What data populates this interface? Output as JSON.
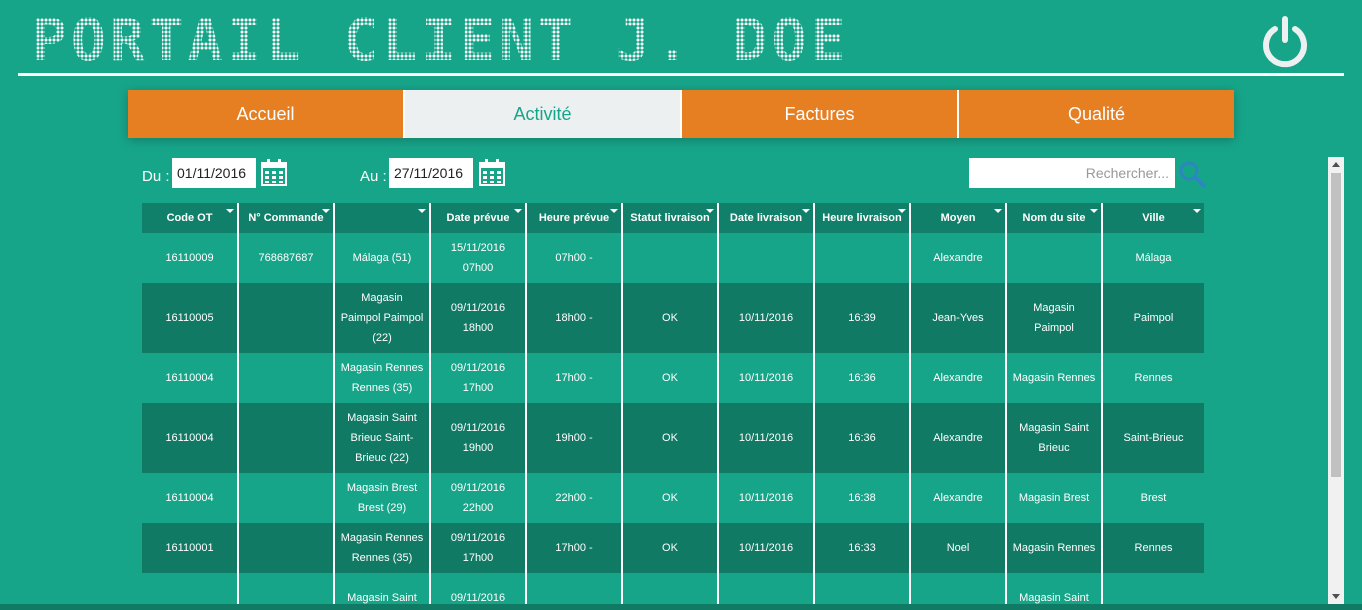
{
  "header": {
    "title": "PORTAIL CLIENT J. DOE",
    "power_icon": "power-icon"
  },
  "tabs": [
    {
      "label": "Accueil",
      "active": false
    },
    {
      "label": "Activité",
      "active": true
    },
    {
      "label": "Factures",
      "active": false
    },
    {
      "label": "Qualité",
      "active": false
    }
  ],
  "filters": {
    "from_label": "Du :",
    "from_value": "01/11/2016",
    "to_label": "Au :",
    "to_value": "27/11/2016",
    "calendar_icon": "calendar-icon",
    "search_placeholder": "Rechercher...",
    "search_icon": "search-icon"
  },
  "table": {
    "columns": [
      "Code OT",
      "N° Commande",
      "",
      "Date prévue",
      "Heure prévue",
      "Statut livraison",
      "Date livraison",
      "Heure livraison",
      "Moyen",
      "Nom du site",
      "Ville"
    ],
    "rows": [
      [
        "16110009",
        "768687687",
        "Málaga (51)",
        "15/11/2016\n07h00",
        "07h00 -",
        "",
        "",
        "",
        "Alexandre",
        "",
        "Málaga"
      ],
      [
        "16110005",
        "",
        "Magasin\nPaimpol Paimpol\n(22)",
        "09/11/2016\n18h00",
        "18h00 -",
        "OK",
        "10/11/2016",
        "16:39",
        "Jean-Yves",
        "Magasin\nPaimpol",
        "Paimpol"
      ],
      [
        "16110004",
        "",
        "Magasin Rennes\nRennes (35)",
        "09/11/2016\n17h00",
        "17h00 -",
        "OK",
        "10/11/2016",
        "16:36",
        "Alexandre",
        "Magasin Rennes",
        "Rennes"
      ],
      [
        "16110004",
        "",
        "Magasin Saint\nBrieuc Saint-\nBrieuc (22)",
        "09/11/2016\n19h00",
        "19h00 -",
        "OK",
        "10/11/2016",
        "16:36",
        "Alexandre",
        "Magasin Saint\nBrieuc",
        "Saint-Brieuc"
      ],
      [
        "16110004",
        "",
        "Magasin Brest\nBrest (29)",
        "09/11/2016\n22h00",
        "22h00 -",
        "OK",
        "10/11/2016",
        "16:38",
        "Alexandre",
        "Magasin Brest",
        "Brest"
      ],
      [
        "16110001",
        "",
        "Magasin Rennes\nRennes (35)",
        "09/11/2016\n17h00",
        "17h00 -",
        "OK",
        "10/11/2016",
        "16:33",
        "Noel",
        "Magasin Rennes",
        "Rennes"
      ],
      [
        "",
        "",
        "Magasin Saint",
        "09/11/2016",
        "",
        "",
        "",
        "",
        "",
        "Magasin Saint",
        ""
      ]
    ]
  },
  "colors": {
    "background": "#17a589",
    "row_dark": "#117a65",
    "tab_orange": "#e67e22",
    "tab_active": "#ecf0f1"
  }
}
